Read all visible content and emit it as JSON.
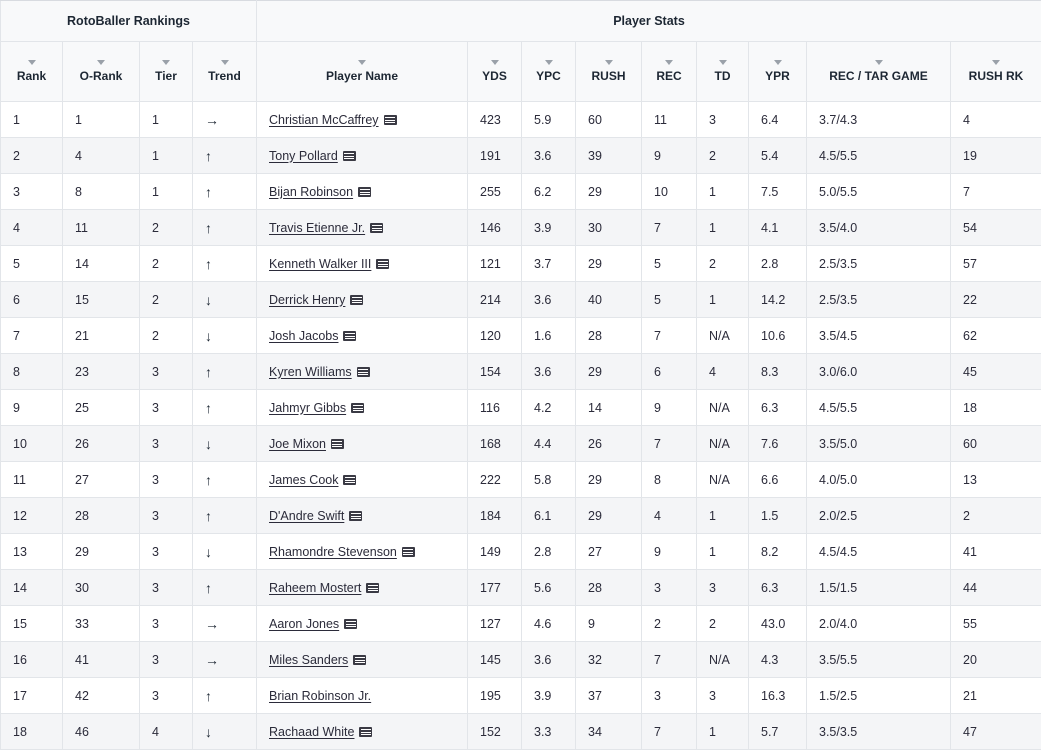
{
  "groups": [
    {
      "label": "RotoBaller Rankings",
      "span": 4
    },
    {
      "label": "Player Stats",
      "span": 9
    }
  ],
  "columns": [
    {
      "key": "rank",
      "label": "Rank"
    },
    {
      "key": "orank",
      "label": "O-Rank"
    },
    {
      "key": "tier",
      "label": "Tier"
    },
    {
      "key": "trend",
      "label": "Trend"
    },
    {
      "key": "name",
      "label": "Player Name"
    },
    {
      "key": "yds",
      "label": "YDS"
    },
    {
      "key": "ypc",
      "label": "YPC"
    },
    {
      "key": "rush",
      "label": "RUSH"
    },
    {
      "key": "rec",
      "label": "REC"
    },
    {
      "key": "td",
      "label": "TD"
    },
    {
      "key": "ypr",
      "label": "YPR"
    },
    {
      "key": "rtg",
      "label": "REC / TAR GAME"
    },
    {
      "key": "rushrk",
      "label": "RUSH RK"
    }
  ],
  "icons": {
    "sort": "sort-caret-down-icon",
    "news": "player-news-icon",
    "trend_up": "↑",
    "trend_down": "↓",
    "trend_flat": "→"
  },
  "colors": {
    "header_bg": "#f8f9fa",
    "row_alt_bg": "#f4f5f7",
    "border": "#e2e5e9",
    "text": "#2b2b3a",
    "caret": "#9aa1a9"
  },
  "rows": [
    {
      "rank": "1",
      "orank": "1",
      "tier": "1",
      "trend": "→",
      "name": "Christian McCaffrey",
      "has_news": true,
      "yds": "423",
      "ypc": "5.9",
      "rush": "60",
      "rec": "11",
      "td": "3",
      "ypr": "6.4",
      "rtg": "3.7/4.3",
      "rushrk": "4"
    },
    {
      "rank": "2",
      "orank": "4",
      "tier": "1",
      "trend": "↑",
      "name": "Tony Pollard",
      "has_news": true,
      "yds": "191",
      "ypc": "3.6",
      "rush": "39",
      "rec": "9",
      "td": "2",
      "ypr": "5.4",
      "rtg": "4.5/5.5",
      "rushrk": "19"
    },
    {
      "rank": "3",
      "orank": "8",
      "tier": "1",
      "trend": "↑",
      "name": "Bijan Robinson",
      "has_news": true,
      "yds": "255",
      "ypc": "6.2",
      "rush": "29",
      "rec": "10",
      "td": "1",
      "ypr": "7.5",
      "rtg": "5.0/5.5",
      "rushrk": "7"
    },
    {
      "rank": "4",
      "orank": "11",
      "tier": "2",
      "trend": "↑",
      "name": "Travis Etienne Jr.",
      "has_news": true,
      "yds": "146",
      "ypc": "3.9",
      "rush": "30",
      "rec": "7",
      "td": "1",
      "ypr": "4.1",
      "rtg": "3.5/4.0",
      "rushrk": "54"
    },
    {
      "rank": "5",
      "orank": "14",
      "tier": "2",
      "trend": "↑",
      "name": "Kenneth Walker III",
      "has_news": true,
      "yds": "121",
      "ypc": "3.7",
      "rush": "29",
      "rec": "5",
      "td": "2",
      "ypr": "2.8",
      "rtg": "2.5/3.5",
      "rushrk": "57"
    },
    {
      "rank": "6",
      "orank": "15",
      "tier": "2",
      "trend": "↓",
      "name": "Derrick Henry",
      "has_news": true,
      "yds": "214",
      "ypc": "3.6",
      "rush": "40",
      "rec": "5",
      "td": "1",
      "ypr": "14.2",
      "rtg": "2.5/3.5",
      "rushrk": "22"
    },
    {
      "rank": "7",
      "orank": "21",
      "tier": "2",
      "trend": "↓",
      "name": "Josh Jacobs",
      "has_news": true,
      "yds": "120",
      "ypc": "1.6",
      "rush": "28",
      "rec": "7",
      "td": "N/A",
      "ypr": "10.6",
      "rtg": "3.5/4.5",
      "rushrk": "62"
    },
    {
      "rank": "8",
      "orank": "23",
      "tier": "3",
      "trend": "↑",
      "name": "Kyren Williams",
      "has_news": true,
      "yds": "154",
      "ypc": "3.6",
      "rush": "29",
      "rec": "6",
      "td": "4",
      "ypr": "8.3",
      "rtg": "3.0/6.0",
      "rushrk": "45"
    },
    {
      "rank": "9",
      "orank": "25",
      "tier": "3",
      "trend": "↑",
      "name": "Jahmyr Gibbs",
      "has_news": true,
      "yds": "116",
      "ypc": "4.2",
      "rush": "14",
      "rec": "9",
      "td": "N/A",
      "ypr": "6.3",
      "rtg": "4.5/5.5",
      "rushrk": "18"
    },
    {
      "rank": "10",
      "orank": "26",
      "tier": "3",
      "trend": "↓",
      "name": "Joe Mixon",
      "has_news": true,
      "yds": "168",
      "ypc": "4.4",
      "rush": "26",
      "rec": "7",
      "td": "N/A",
      "ypr": "7.6",
      "rtg": "3.5/5.0",
      "rushrk": "60"
    },
    {
      "rank": "11",
      "orank": "27",
      "tier": "3",
      "trend": "↑",
      "name": "James Cook",
      "has_news": true,
      "yds": "222",
      "ypc": "5.8",
      "rush": "29",
      "rec": "8",
      "td": "N/A",
      "ypr": "6.6",
      "rtg": "4.0/5.0",
      "rushrk": "13"
    },
    {
      "rank": "12",
      "orank": "28",
      "tier": "3",
      "trend": "↑",
      "name": "D'Andre Swift",
      "has_news": true,
      "yds": "184",
      "ypc": "6.1",
      "rush": "29",
      "rec": "4",
      "td": "1",
      "ypr": "1.5",
      "rtg": "2.0/2.5",
      "rushrk": "2"
    },
    {
      "rank": "13",
      "orank": "29",
      "tier": "3",
      "trend": "↓",
      "name": "Rhamondre Stevenson",
      "has_news": true,
      "yds": "149",
      "ypc": "2.8",
      "rush": "27",
      "rec": "9",
      "td": "1",
      "ypr": "8.2",
      "rtg": "4.5/4.5",
      "rushrk": "41"
    },
    {
      "rank": "14",
      "orank": "30",
      "tier": "3",
      "trend": "↑",
      "name": "Raheem Mostert",
      "has_news": true,
      "yds": "177",
      "ypc": "5.6",
      "rush": "28",
      "rec": "3",
      "td": "3",
      "ypr": "6.3",
      "rtg": "1.5/1.5",
      "rushrk": "44"
    },
    {
      "rank": "15",
      "orank": "33",
      "tier": "3",
      "trend": "→",
      "name": "Aaron Jones",
      "has_news": true,
      "yds": "127",
      "ypc": "4.6",
      "rush": "9",
      "rec": "2",
      "td": "2",
      "ypr": "43.0",
      "rtg": "2.0/4.0",
      "rushrk": "55"
    },
    {
      "rank": "16",
      "orank": "41",
      "tier": "3",
      "trend": "→",
      "name": "Miles Sanders",
      "has_news": true,
      "yds": "145",
      "ypc": "3.6",
      "rush": "32",
      "rec": "7",
      "td": "N/A",
      "ypr": "4.3",
      "rtg": "3.5/5.5",
      "rushrk": "20"
    },
    {
      "rank": "17",
      "orank": "42",
      "tier": "3",
      "trend": "↑",
      "name": "Brian Robinson Jr.",
      "has_news": false,
      "yds": "195",
      "ypc": "3.9",
      "rush": "37",
      "rec": "3",
      "td": "3",
      "ypr": "16.3",
      "rtg": "1.5/2.5",
      "rushrk": "21"
    },
    {
      "rank": "18",
      "orank": "46",
      "tier": "4",
      "trend": "↓",
      "name": "Rachaad White",
      "has_news": true,
      "yds": "152",
      "ypc": "3.3",
      "rush": "34",
      "rec": "7",
      "td": "1",
      "ypr": "5.7",
      "rtg": "3.5/3.5",
      "rushrk": "47"
    }
  ]
}
